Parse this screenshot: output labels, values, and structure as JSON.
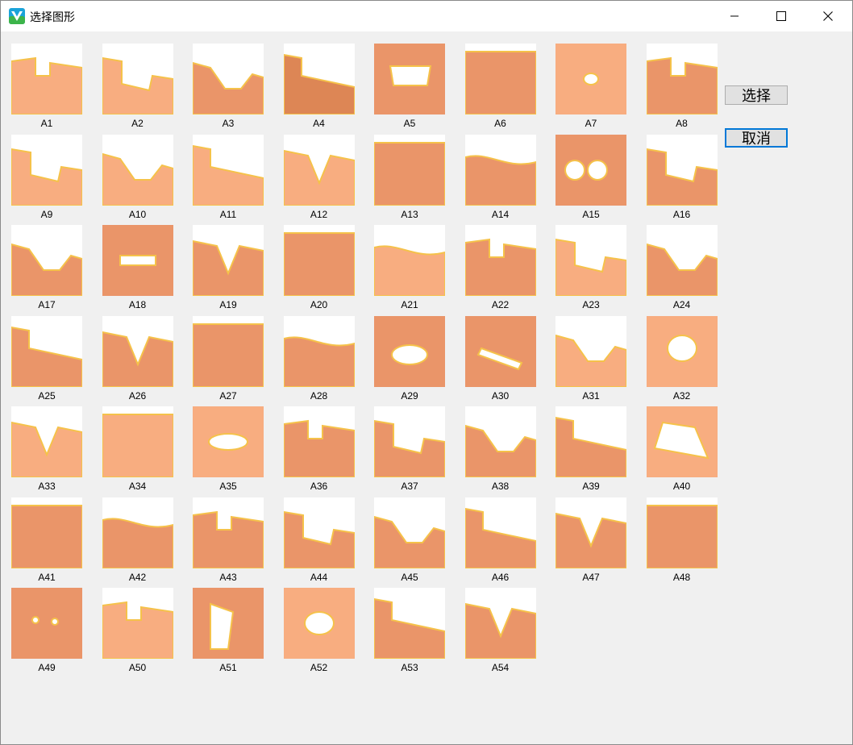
{
  "window": {
    "title": "选择图形",
    "buttons": {
      "select": "选择",
      "cancel": "取消"
    },
    "controls": [
      "minimize-icon",
      "maximize-icon",
      "close-icon"
    ]
  },
  "colors": {
    "light_fill": "#f8ad80",
    "mid_fill": "#ea9569",
    "dark_fill": "#dd8655",
    "edge": "#f5c24a",
    "focus": "#0078d7"
  },
  "shapes": [
    {
      "label": "A1",
      "tone": "light"
    },
    {
      "label": "A2",
      "tone": "light"
    },
    {
      "label": "A3",
      "tone": "mid"
    },
    {
      "label": "A4",
      "tone": "dark"
    },
    {
      "label": "A5",
      "tone": "mid"
    },
    {
      "label": "A6",
      "tone": "mid"
    },
    {
      "label": "A7",
      "tone": "light"
    },
    {
      "label": "A8",
      "tone": "mid"
    },
    {
      "label": "A9",
      "tone": "light"
    },
    {
      "label": "A10",
      "tone": "light"
    },
    {
      "label": "A11",
      "tone": "light"
    },
    {
      "label": "A12",
      "tone": "light"
    },
    {
      "label": "A13",
      "tone": "mid"
    },
    {
      "label": "A14",
      "tone": "mid"
    },
    {
      "label": "A15",
      "tone": "mid"
    },
    {
      "label": "A16",
      "tone": "mid"
    },
    {
      "label": "A17",
      "tone": "mid"
    },
    {
      "label": "A18",
      "tone": "mid"
    },
    {
      "label": "A19",
      "tone": "mid"
    },
    {
      "label": "A20",
      "tone": "mid"
    },
    {
      "label": "A21",
      "tone": "light"
    },
    {
      "label": "A22",
      "tone": "mid"
    },
    {
      "label": "A23",
      "tone": "light"
    },
    {
      "label": "A24",
      "tone": "mid"
    },
    {
      "label": "A25",
      "tone": "mid"
    },
    {
      "label": "A26",
      "tone": "mid"
    },
    {
      "label": "A27",
      "tone": "mid"
    },
    {
      "label": "A28",
      "tone": "mid"
    },
    {
      "label": "A29",
      "tone": "mid"
    },
    {
      "label": "A30",
      "tone": "mid"
    },
    {
      "label": "A31",
      "tone": "light"
    },
    {
      "label": "A32",
      "tone": "light"
    },
    {
      "label": "A33",
      "tone": "light"
    },
    {
      "label": "A34",
      "tone": "light"
    },
    {
      "label": "A35",
      "tone": "light"
    },
    {
      "label": "A36",
      "tone": "mid"
    },
    {
      "label": "A37",
      "tone": "mid"
    },
    {
      "label": "A38",
      "tone": "mid"
    },
    {
      "label": "A39",
      "tone": "mid"
    },
    {
      "label": "A40",
      "tone": "light"
    },
    {
      "label": "A41",
      "tone": "mid"
    },
    {
      "label": "A42",
      "tone": "mid"
    },
    {
      "label": "A43",
      "tone": "mid"
    },
    {
      "label": "A44",
      "tone": "mid"
    },
    {
      "label": "A45",
      "tone": "mid"
    },
    {
      "label": "A46",
      "tone": "mid"
    },
    {
      "label": "A47",
      "tone": "mid"
    },
    {
      "label": "A48",
      "tone": "mid"
    },
    {
      "label": "A49",
      "tone": "mid"
    },
    {
      "label": "A50",
      "tone": "light"
    },
    {
      "label": "A51",
      "tone": "mid"
    },
    {
      "label": "A52",
      "tone": "light"
    },
    {
      "label": "A53",
      "tone": "mid"
    },
    {
      "label": "A54",
      "tone": "mid"
    }
  ]
}
